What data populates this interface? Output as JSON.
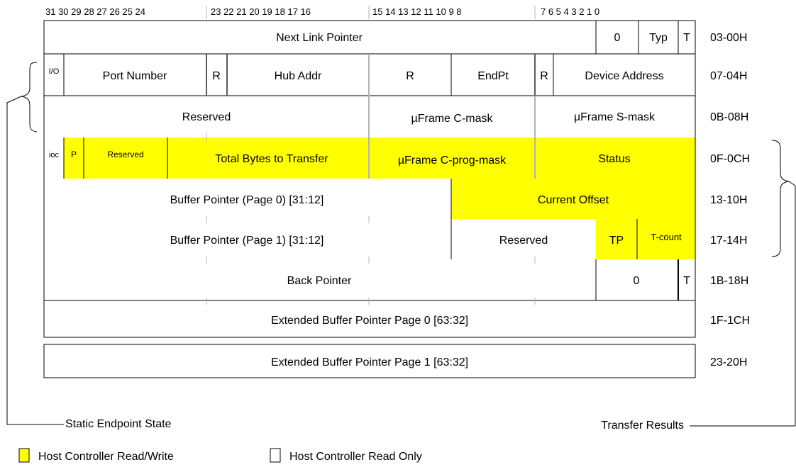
{
  "bit_ranges": [
    "31 30 29 28 27 26 25 24",
    "23 22 21 20 19 18 17 16",
    "15 14 13 12 11 10 9 8",
    "7 6 5 4 3 2 1 0"
  ],
  "rows": [
    {
      "offset": "03-00H",
      "fields": [
        "Next Link Pointer",
        "0",
        "Typ",
        "T"
      ]
    },
    {
      "offset": "07-04H",
      "fields": [
        "I/O",
        "Port Number",
        "R",
        "Hub Addr",
        "R",
        "EndPt",
        "R",
        "Device Address"
      ]
    },
    {
      "offset": "0B-08H",
      "fields": [
        "Reserved",
        "µFrame C-mask",
        "µFrame S-mask"
      ]
    },
    {
      "offset": "0F-0CH",
      "fields": [
        "ioc",
        "P",
        "Reserved",
        "Total Bytes to Transfer",
        "µFrame C-prog-mask",
        "Status"
      ]
    },
    {
      "offset": "13-10H",
      "fields": [
        "Buffer Pointer (Page 0) [31:12]",
        "Current Offset"
      ]
    },
    {
      "offset": "17-14H",
      "fields": [
        "Buffer Pointer (Page 1) [31:12]",
        "Reserved",
        "TP",
        "T-count"
      ]
    },
    {
      "offset": "1B-18H",
      "fields": [
        "Back Pointer",
        "0",
        "T"
      ]
    },
    {
      "offset": "1F-1CH",
      "fields": [
        "Extended Buffer Pointer Page 0 [63:32]"
      ]
    },
    {
      "offset": "23-20H",
      "fields": [
        "Extended Buffer Pointer Page 1 [63:32]"
      ]
    }
  ],
  "brackets": {
    "left_label": "Static Endpoint State",
    "right_label": "Transfer Results"
  },
  "legend": [
    {
      "label": "Host Controller Read/Write",
      "color": "#ffff00"
    },
    {
      "label": "Host Controller Read Only",
      "color": "#ffffff"
    }
  ],
  "colors": {
    "highlight": "#ffff00",
    "line": "#000000",
    "guide": "#b3b3b3"
  }
}
